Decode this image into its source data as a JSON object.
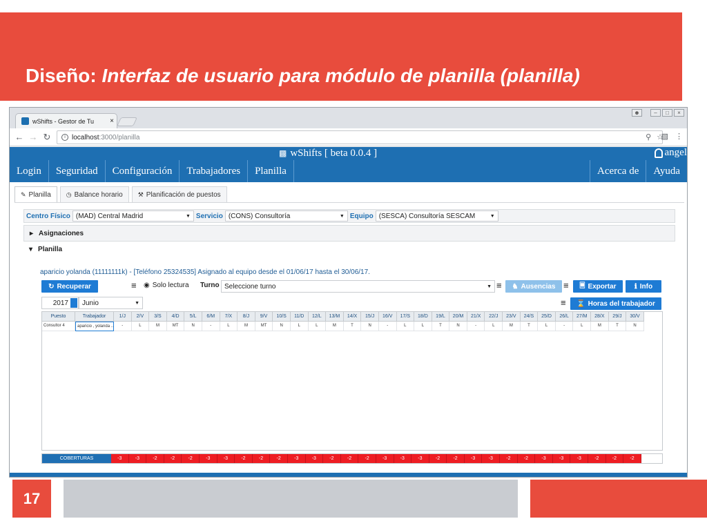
{
  "slide": {
    "title_prefix": "Diseño:",
    "title_rest": "Interfaz de usuario para módulo de planilla (planilla)",
    "page_number": "17"
  },
  "browser": {
    "tab_title": "wShifts - Gestor de Tu",
    "tab_close": "×",
    "url_host": "localhost",
    "url_path": ":3000/planilla"
  },
  "app": {
    "brand": "wShifts [ beta 0.0.4 ]",
    "user": "angel",
    "menu_left": [
      "Login",
      "Seguridad",
      "Configuración",
      "Trabajadores",
      "Planilla"
    ],
    "menu_right": [
      "Acerca de",
      "Ayuda"
    ],
    "tabs": [
      "Planilla",
      "Balance horario",
      "Planificación de puestos"
    ]
  },
  "filters": {
    "centro_label": "Centro Físico",
    "centro_value": "(MAD) Central Madrid",
    "servicio_label": "Servicio",
    "servicio_value": "(CONS) Consultoría",
    "equipo_label": "Equipo",
    "equipo_value": "(SESCA) Consultoría SESCAM"
  },
  "sections": {
    "asignaciones": "Asignaciones",
    "planilla": "Planilla"
  },
  "planilla": {
    "assignment_line": "aparicio yolanda (11111111k) - [Teléfono 25324535] Asignado al equipo desde el 01/06/17 hasta el 30/06/17.",
    "recuperar": "Recuperar",
    "solo_lectura": "Solo lectura",
    "turno_label": "Turno",
    "turno_placeholder": "Seleccione turno",
    "ausencias": "Ausencias",
    "exportar": "Exportar",
    "info": "Info",
    "year": "2017",
    "month": "Junio",
    "horas": "Horas del trabajador"
  },
  "grid": {
    "head_puesto": "Puesto",
    "head_trabajador": "Trabajador",
    "days": [
      "1/J",
      "2/V",
      "3/S",
      "4/D",
      "5/L",
      "6/M",
      "7/X",
      "8/J",
      "9/V",
      "10/S",
      "11/D",
      "12/L",
      "13/M",
      "14/X",
      "15/J",
      "16/V",
      "17/S",
      "18/D",
      "19/L",
      "20/M",
      "21/X",
      "22/J",
      "23/V",
      "24/S",
      "25/D",
      "26/L",
      "27/M",
      "28/X",
      "29/J",
      "30/V"
    ],
    "row": {
      "puesto": "Consultor 4",
      "trabajador": "aparicio , yolanda ...",
      "values": [
        "-",
        "L",
        "M",
        "MT",
        "N",
        "-",
        "L",
        "M",
        "MT",
        "N",
        "L",
        "L",
        "M",
        "T",
        "N",
        "-",
        "L",
        "L",
        "T",
        "N",
        "-",
        "L",
        "M",
        "T",
        "L",
        "-",
        "L",
        "M",
        "T",
        "N"
      ]
    },
    "coberturas_label": "COBERTURAS",
    "coberturas": [
      "-3",
      "-3",
      "-2",
      "-2",
      "-2",
      "-3",
      "-3",
      "-2",
      "-2",
      "-2",
      "-3",
      "-3",
      "-2",
      "-2",
      "-2",
      "-3",
      "-3",
      "-3",
      "-2",
      "-2",
      "-3",
      "-3",
      "-2",
      "-2",
      "-3",
      "-3",
      "-3",
      "-2",
      "-2",
      "-2"
    ]
  },
  "colors": {
    "slide_red": "#e84c3d",
    "app_blue": "#1e6fb2",
    "button_blue": "#1e7bd4",
    "cobertura_red": "#ee1d23"
  }
}
